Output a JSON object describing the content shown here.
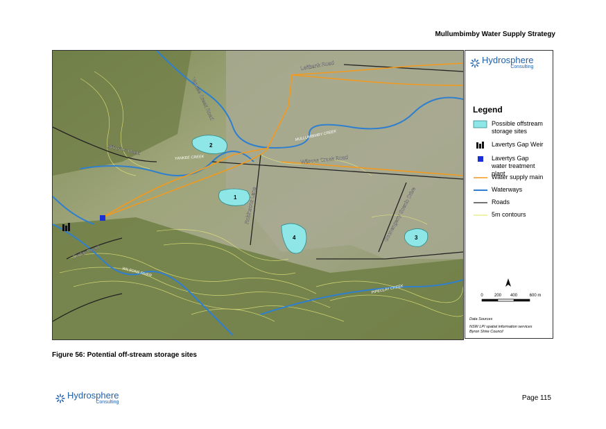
{
  "header": {
    "title": "Mullumbimby Water Supply Strategy"
  },
  "map": {
    "road_labels": {
      "leftbank": "Leftbank Road",
      "yankee_creek_road": "Yankee Creek Road",
      "alideries": "Alideries Road",
      "wilsons_creek_road": "Wilsons Creek Road",
      "robinsons": "Robinsons Lane",
      "goonengerry": "Goonengerry Scenic Drive",
      "cedar": "Cedar Road"
    },
    "water_labels": {
      "mullumbimby_creek": "MULLUMBIMBY CREEK",
      "yankee_creek": "YANKEE CREEK",
      "wilsons_river": "WILSONS RIVER",
      "pipeclay_creek": "PIPECLAY CREEK"
    },
    "sites": [
      "1",
      "2",
      "3",
      "4"
    ],
    "colors": {
      "site_fill": "#8ee6e6",
      "waterway": "#2f7fcf",
      "water_main": "#f29a1e",
      "road": "#222222",
      "contour": "#e8ea7a",
      "plant": "#1a2fd6"
    }
  },
  "legend": {
    "logo_brand": "Hydrosphere",
    "logo_sub": "Consulting",
    "title": "Legend",
    "items": [
      {
        "label": "Possible offstream storage sites"
      },
      {
        "label": "Lavertys Gap Weir"
      },
      {
        "label": "Lavertys Gap water treatment plant"
      },
      {
        "label": "Water supply main"
      },
      {
        "label": "Waterways"
      },
      {
        "label": "Roads"
      },
      {
        "label": "5m contours"
      }
    ],
    "scale": {
      "ticks": [
        "0",
        "200",
        "400",
        "600 m"
      ]
    },
    "data_sources_title": "Data Sources",
    "data_sources": [
      "NSW LPI spatial information services",
      "Byron Shire Council"
    ]
  },
  "caption": "Figure 56: Potential off-stream storage sites",
  "footer": {
    "logo_brand": "Hydrosphere",
    "logo_sub": "Consulting",
    "page": "Page 115"
  }
}
